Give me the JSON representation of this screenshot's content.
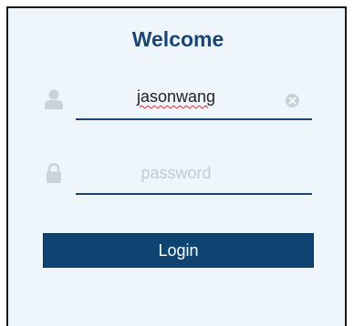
{
  "form": {
    "title": "Welcome",
    "username": {
      "value": "jasonwang",
      "icon": "user-icon",
      "clear_icon": "clear-icon"
    },
    "password": {
      "placeholder": "password",
      "value": "",
      "icon": "lock-icon"
    },
    "login_label": "Login"
  },
  "colors": {
    "panel_background": "#eef6fc",
    "accent": "#1a4570",
    "button_background": "#0f4472",
    "icon": "#c9d2db",
    "placeholder": "#c3ccd5"
  }
}
